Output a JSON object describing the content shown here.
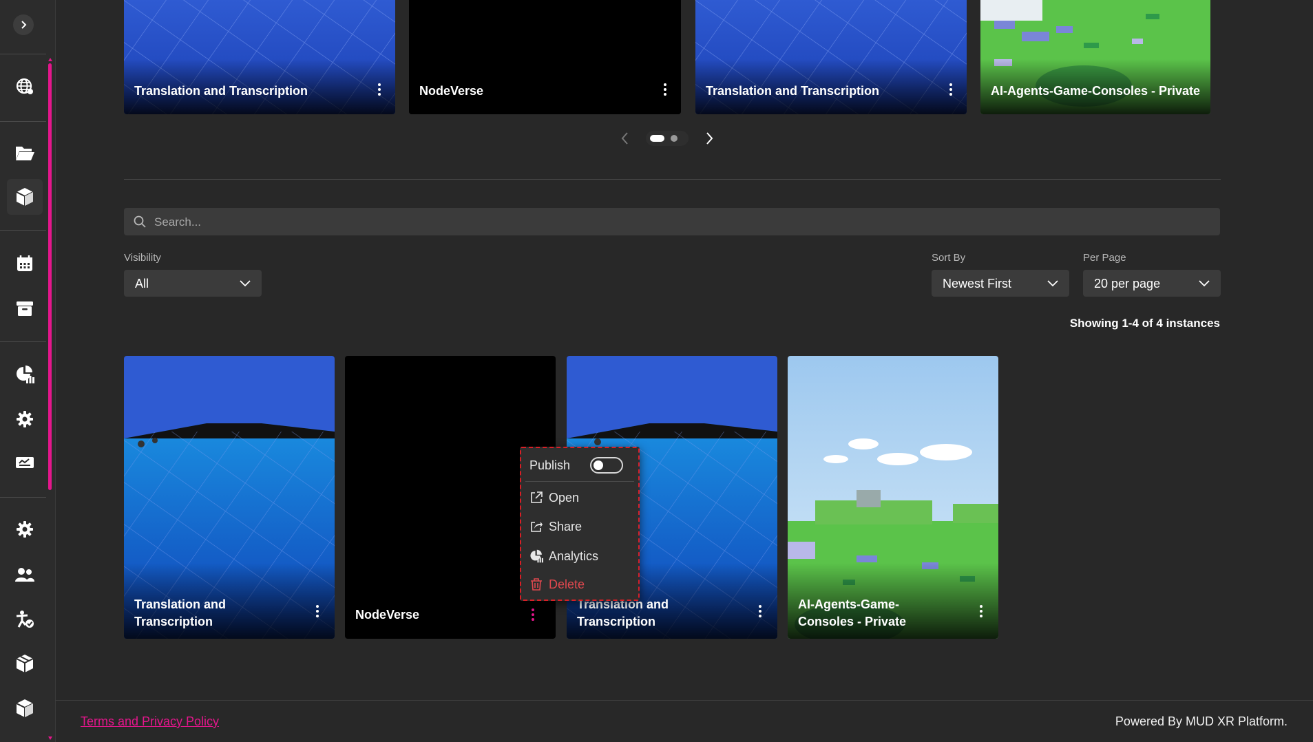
{
  "sidebar": {
    "toggle_icon": "chevron-right-icon",
    "accent_color": "#e4168c",
    "icons": [
      "globe-icon",
      "folder-open-icon",
      "cube-icon",
      "calendar-icon",
      "archive-icon",
      "analytics-icon",
      "settings-icon",
      "ticket-icon",
      "settings-icon",
      "users-icon",
      "accessibility-icon",
      "boxes-icon",
      "cube-icon"
    ]
  },
  "carousel": {
    "cards": [
      {
        "title": "Translation and Transcription",
        "thumb": "blue-grid"
      },
      {
        "title": "NodeVerse",
        "thumb": "black"
      },
      {
        "title": "Translation and Transcription",
        "thumb": "blue-grid"
      },
      {
        "title": "AI-Agents-Game-Consoles - Private",
        "thumb": "green-world"
      }
    ],
    "pages": 2,
    "current_page": 1
  },
  "search": {
    "placeholder": "Search..."
  },
  "filters": {
    "visibility": {
      "label": "Visibility",
      "value": "All"
    },
    "sort_by": {
      "label": "Sort By",
      "value": "Newest First"
    },
    "per_page": {
      "label": "Per Page",
      "value": "20 per page"
    }
  },
  "showing_text": "Showing 1-4 of 4 instances",
  "grid": {
    "cards": [
      {
        "title": "Translation and Transcription"
      },
      {
        "title": "NodeVerse"
      },
      {
        "title": "Translation and Transcription"
      },
      {
        "title": "AI-Agents-Game-Consoles - Private"
      }
    ]
  },
  "context_menu": {
    "publish_label": "Publish",
    "publish_on": false,
    "items": [
      {
        "label": "Open",
        "icon": "external-link-icon"
      },
      {
        "label": "Share",
        "icon": "share-icon"
      },
      {
        "label": "Analytics",
        "icon": "analytics-icon"
      },
      {
        "label": "Delete",
        "icon": "trash-icon",
        "color": "#e0484e"
      }
    ]
  },
  "footer": {
    "terms_label": "Terms and Privacy Policy",
    "powered_by": "Powered By MUD XR Platform."
  }
}
